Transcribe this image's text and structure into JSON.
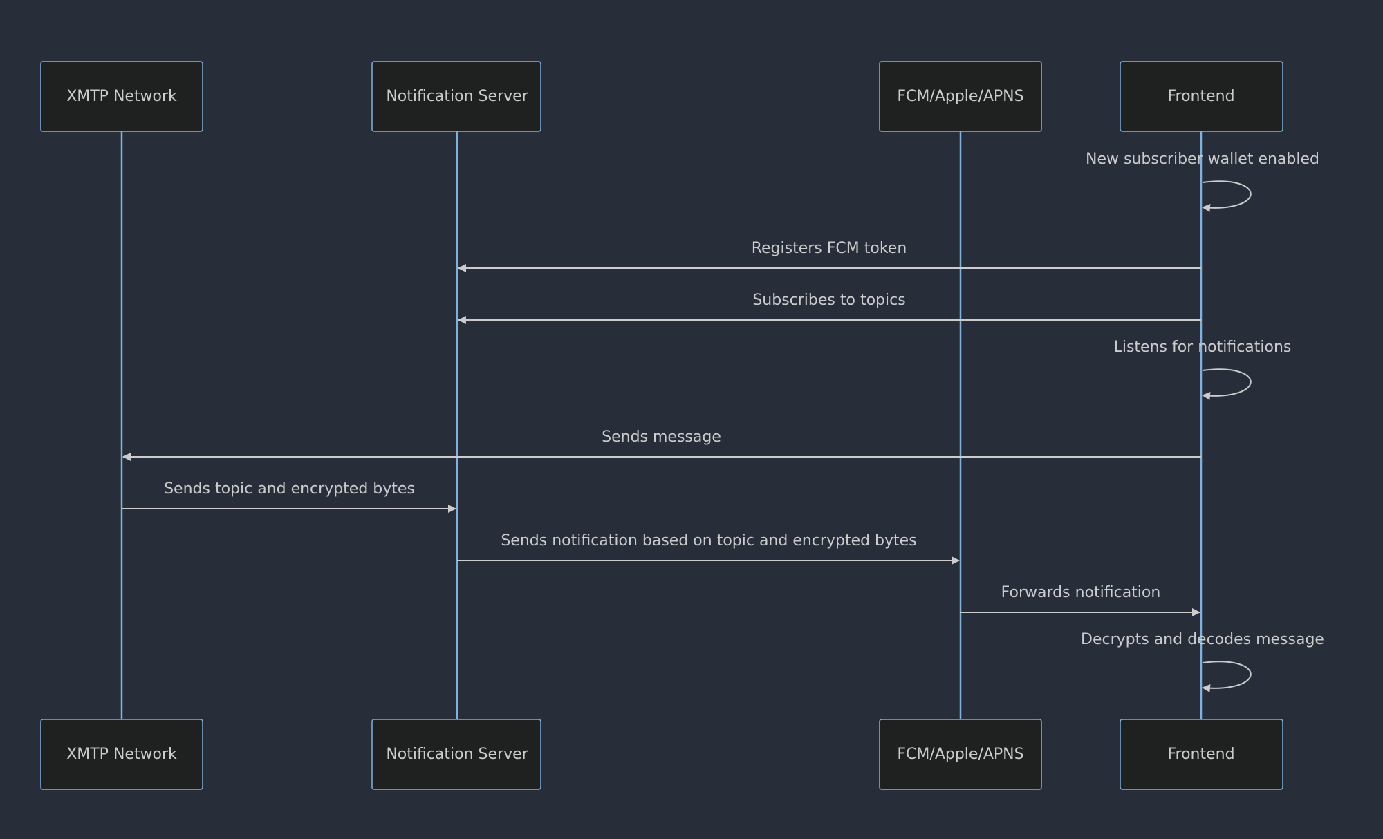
{
  "participants": [
    {
      "id": "xmtp",
      "label": "XMTP Network"
    },
    {
      "id": "notif",
      "label": "Notification Server"
    },
    {
      "id": "fcm",
      "label": "FCM/Apple/APNS"
    },
    {
      "id": "frontend",
      "label": "Frontend"
    }
  ],
  "messages": [
    {
      "from": "frontend",
      "to": "frontend",
      "text": "New subscriber wallet enabled"
    },
    {
      "from": "frontend",
      "to": "notif",
      "text": "Registers FCM token"
    },
    {
      "from": "frontend",
      "to": "notif",
      "text": "Subscribes to topics"
    },
    {
      "from": "frontend",
      "to": "frontend",
      "text": "Listens for notifications"
    },
    {
      "from": "frontend",
      "to": "xmtp",
      "text": "Sends message"
    },
    {
      "from": "xmtp",
      "to": "notif",
      "text": "Sends topic and encrypted bytes"
    },
    {
      "from": "notif",
      "to": "fcm",
      "text": "Sends notification based on topic and encrypted bytes"
    },
    {
      "from": "fcm",
      "to": "frontend",
      "text": "Forwards notification"
    },
    {
      "from": "frontend",
      "to": "frontend",
      "text": "Decrypts and decodes message"
    }
  ],
  "colors": {
    "background": "#282d3a",
    "actor_fill": "#1f2020",
    "actor_border": "#81b1db",
    "line": "#cccccc",
    "text": "#cccccc"
  }
}
